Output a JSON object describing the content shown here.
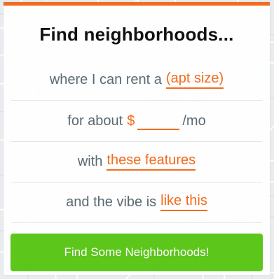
{
  "colors": {
    "accent": "#f26b1d",
    "cta": "#5cc61a",
    "muted_text": "#5a6a72",
    "title_text": "#111111"
  },
  "form": {
    "title": "Find neighborhoods...",
    "rent_row": {
      "prefix": "where I can rent a",
      "link": "(apt size)"
    },
    "price_row": {
      "prefix": "for about",
      "currency": "$",
      "value": "",
      "suffix": "/mo"
    },
    "features_row": {
      "prefix": "with",
      "link": "these features"
    },
    "vibe_row": {
      "prefix": "and the vibe is",
      "link": "like this"
    },
    "submit_label": "Find Some Neighborhoods!"
  }
}
